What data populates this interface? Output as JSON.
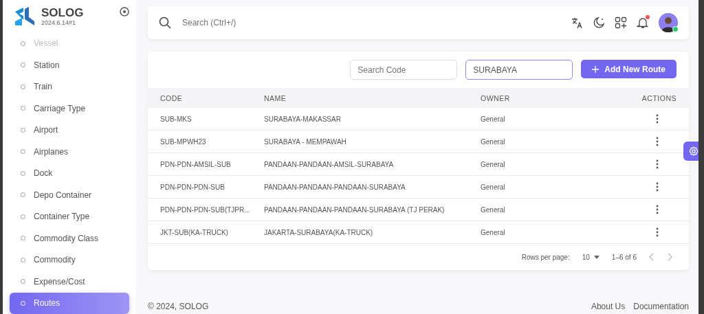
{
  "brand": {
    "name": "SOLOG",
    "version": "2024.6.14#1"
  },
  "sidebar": {
    "items": [
      {
        "label": "Vessel",
        "dimmed": true,
        "selected": false
      },
      {
        "label": "Station",
        "dimmed": false,
        "selected": false
      },
      {
        "label": "Train",
        "dimmed": false,
        "selected": false
      },
      {
        "label": "Carriage Type",
        "dimmed": false,
        "selected": false
      },
      {
        "label": "Airport",
        "dimmed": false,
        "selected": false
      },
      {
        "label": "Airplanes",
        "dimmed": false,
        "selected": false
      },
      {
        "label": "Dock",
        "dimmed": false,
        "selected": false
      },
      {
        "label": "Depo Container",
        "dimmed": false,
        "selected": false
      },
      {
        "label": "Container Type",
        "dimmed": false,
        "selected": false
      },
      {
        "label": "Commodity Class",
        "dimmed": false,
        "selected": false
      },
      {
        "label": "Commodity",
        "dimmed": false,
        "selected": false
      },
      {
        "label": "Expense/Cost",
        "dimmed": false,
        "selected": false
      },
      {
        "label": "Routes",
        "dimmed": false,
        "selected": true
      }
    ]
  },
  "topbar": {
    "search": {
      "placeholder": "Search (Ctrl+/)"
    },
    "notification_dot": true,
    "online": true
  },
  "filters": {
    "code": {
      "placeholder": "Search Code"
    },
    "name": {
      "value": "SURABAYA"
    },
    "add_button": "Add New Route"
  },
  "table": {
    "columns": [
      "CODE",
      "NAME",
      "OWNER",
      "ACTIONS"
    ],
    "rows": [
      {
        "code": "SUB-MKS",
        "name": "SURABAYA-MAKASSAR",
        "owner": "General"
      },
      {
        "code": "SUB-MPWH23",
        "name": "SURABAYA - MEMPAWAH",
        "owner": "General"
      },
      {
        "code": "PDN-PDN-AMSIL-SUB",
        "name": "PANDAAN-PANDAAN-AMSIL-SURABAYA",
        "owner": "General"
      },
      {
        "code": "PDN-PDN-PDN-SUB",
        "name": "PANDAAN-PANDAAN-PANDAAN-SURABAYA",
        "owner": "General"
      },
      {
        "code": "PDN-PDN-PDN-SUB(TJPR...",
        "name": "PANDAAN-PANDAAN-PANDAAN-SURABAYA (TJ PERAK)",
        "owner": "General"
      },
      {
        "code": "JKT-SUB(KA-TRUCK)",
        "name": "JAKARTA-SURABAYA(KA-TRUCK)",
        "owner": "General"
      }
    ]
  },
  "pagination": {
    "rows_label": "Rows per page:",
    "rows_value": "10",
    "range": "1–6 of 6"
  },
  "footer": {
    "copyright": "© 2024, SOLOG",
    "links": [
      "About Us",
      "Documentation"
    ]
  }
}
